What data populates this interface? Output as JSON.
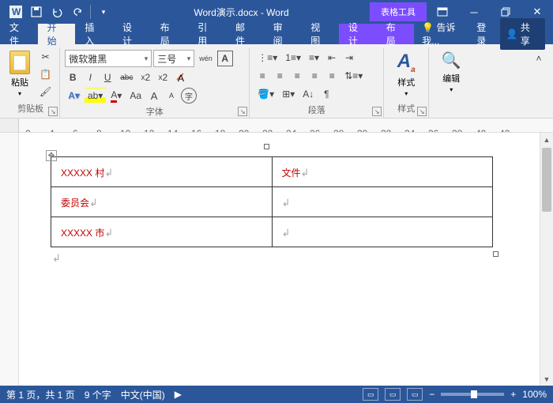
{
  "app": {
    "title": "Word演示.docx - Word",
    "tool_context": "表格工具"
  },
  "qat": {
    "save": "save-icon",
    "undo": "undo-icon",
    "redo": "redo-icon",
    "touch": "touch-icon"
  },
  "window": {
    "min": "minimize",
    "restore": "restore",
    "close": "close",
    "ribbon_opts": "ribbon-display-options"
  },
  "tabs": {
    "file": "文件",
    "home": "开始",
    "insert": "插入",
    "design": "设计",
    "layout": "布局",
    "references": "引用",
    "mailings": "邮件",
    "review": "审阅",
    "view": "视图",
    "ctx_design": "设计",
    "ctx_layout": "布局",
    "tell_me": "告诉我...",
    "login": "登录",
    "share": "共享"
  },
  "ribbon": {
    "clipboard": {
      "label": "剪贴板",
      "paste": "粘贴",
      "cut": "cut",
      "copy": "copy",
      "fmt_painter": "format-painter"
    },
    "font": {
      "label": "字体",
      "family": "微软雅黑",
      "size": "三号",
      "bold": "B",
      "italic": "I",
      "underline": "U",
      "strike": "abc",
      "sub": "x₂",
      "sup": "x²",
      "pinyin": "wén",
      "char_border": "A",
      "effects": "A",
      "highlight": "ab",
      "color": "A",
      "case": "Aa",
      "clear": "clear-formatting",
      "enclose": "字"
    },
    "paragraph": {
      "label": "段落"
    },
    "styles": {
      "label": "样式",
      "btn": "样式"
    },
    "editing": {
      "label": "编辑"
    }
  },
  "ruler": {
    "numbers": [
      2,
      4,
      6,
      8,
      10,
      12,
      14,
      16,
      18,
      20,
      22,
      24,
      26,
      28,
      30,
      32,
      34,
      36,
      38,
      40,
      42
    ]
  },
  "table": {
    "rows": [
      {
        "c1": "XXXXX 村",
        "c2": "文件"
      },
      {
        "c1": "委员会",
        "c2": ""
      },
      {
        "c1": "XXXXX 市",
        "c2": ""
      }
    ]
  },
  "status": {
    "page": "第 1 页，共 1 页",
    "words": "9 个字",
    "lang": "中文(中国)",
    "zoom": "100%"
  }
}
